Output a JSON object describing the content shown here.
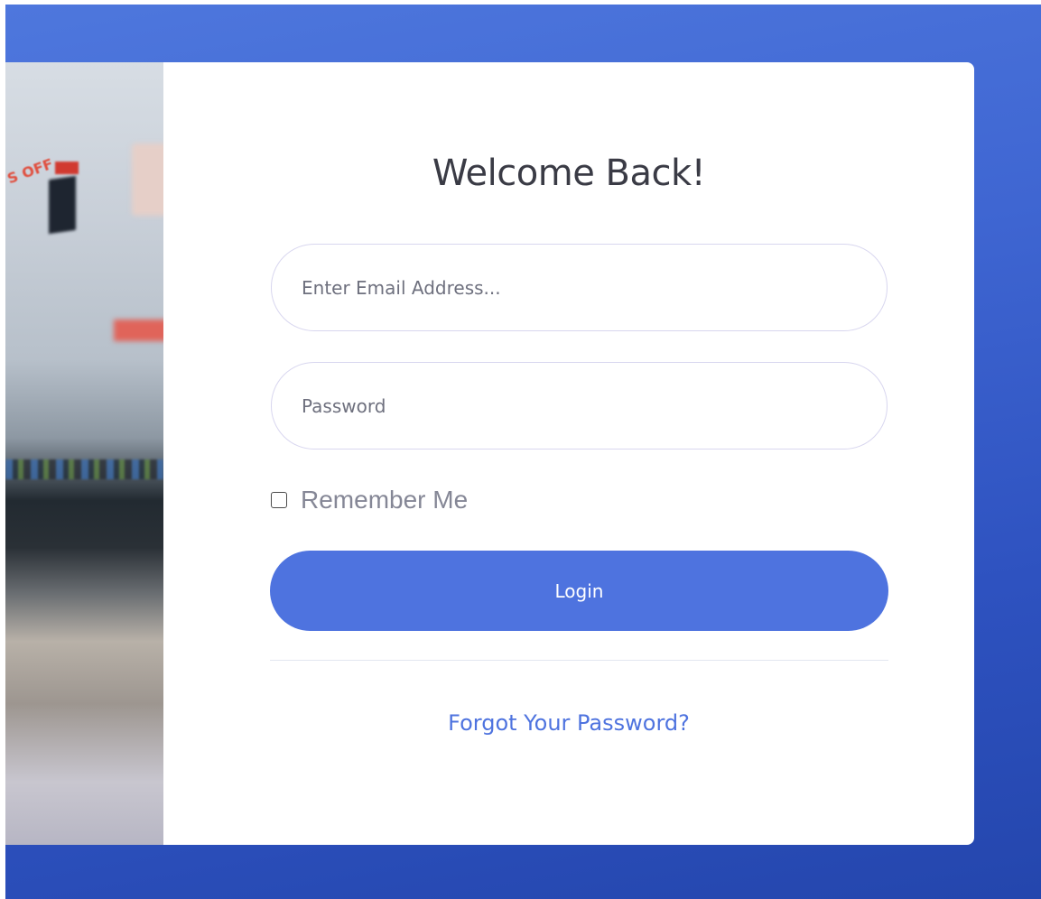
{
  "login": {
    "title": "Welcome Back!",
    "email_placeholder": "Enter Email Address...",
    "password_placeholder": "Password",
    "remember_label": "Remember Me",
    "remember_checked": false,
    "login_label": "Login",
    "forgot_label": "Forgot Your Password?"
  },
  "side_image": {
    "overlay_text": "S OFF"
  },
  "colors": {
    "background_gradient_start": "#4e77dd",
    "background_gradient_end": "#2446ad",
    "primary_button": "#4e73df",
    "link": "#4e73df",
    "title_text": "#3a3b45"
  }
}
